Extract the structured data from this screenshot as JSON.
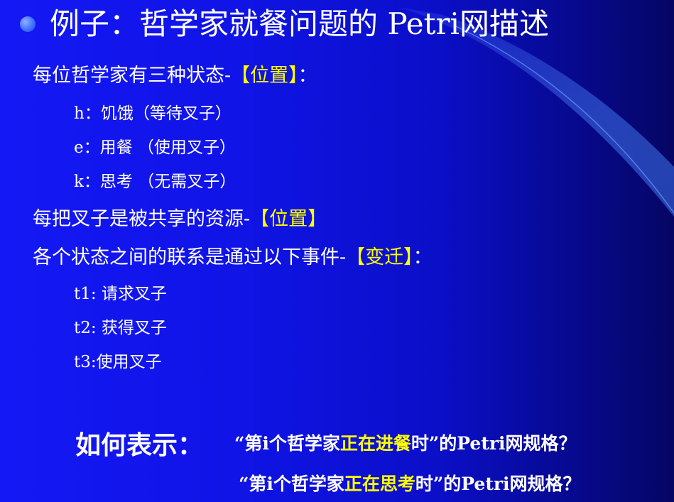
{
  "title": {
    "text": "例子：哲学家就餐问题的 Petri网描述"
  },
  "lines": [
    {
      "prefix": "每位哲学家有三种状态-",
      "highlight": "【位置】",
      "suffix": "："
    },
    {
      "text": "h：饥饿（等待叉子）"
    },
    {
      "text": "e：用餐 （使用叉子）"
    },
    {
      "text": "k：思考 （无需叉子）"
    },
    {
      "prefix": "每把叉子是被共享的资源-",
      "highlight": "【位置】",
      "suffix": ""
    },
    {
      "prefix": "各个状态之间的联系是通过以下事件-",
      "highlight": "【变迁】",
      "suffix": "："
    },
    {
      "text": "t1: 请求叉子"
    },
    {
      "text": "t2: 获得叉子"
    },
    {
      "text": "t3:使用叉子"
    }
  ],
  "question": {
    "label": "如何表示：",
    "q1": {
      "a": "“第i个哲学家",
      "hl": "正在进餐",
      "b": "时”的Petri网规格？"
    },
    "q2": {
      "a": "“第i个哲学家",
      "hl": "正在思考",
      "b": "时”的Petri网规格？"
    }
  },
  "colors": {
    "background": "#1014e6",
    "text": "#ffffff",
    "highlight": "#ffff00",
    "bullet": "#3a6cff"
  }
}
